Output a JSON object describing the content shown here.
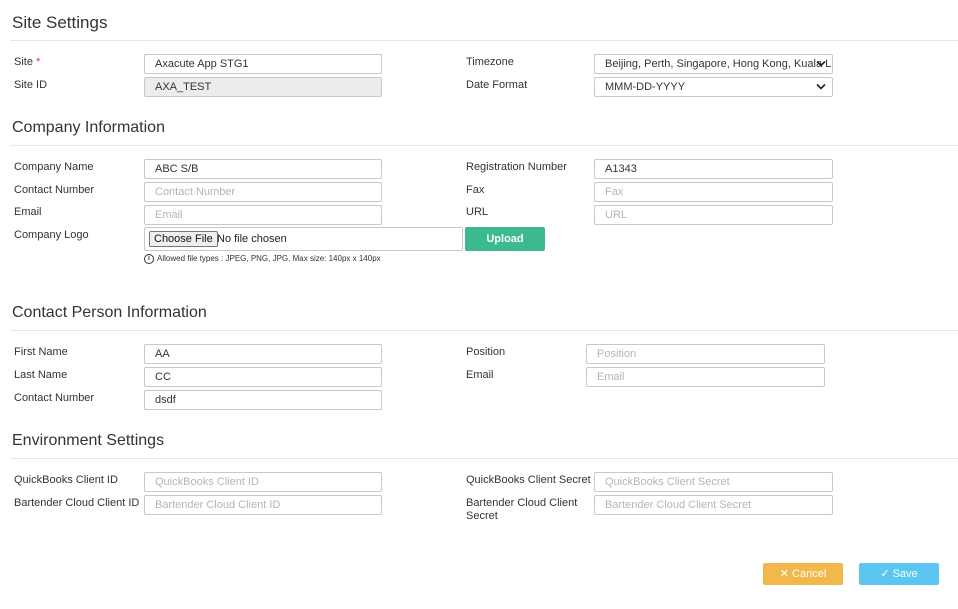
{
  "page": {
    "title": "Site Settings"
  },
  "site": {
    "site_label": "Site",
    "required_marker": "*",
    "site_value": "Axacute App STG1",
    "site_id_label": "Site ID",
    "site_id_value": "AXA_TEST",
    "timezone_label": "Timezone",
    "timezone_value": "Beijing, Perth, Singapore, Hong Kong, Kuala L",
    "date_format_label": "Date Format",
    "date_format_value": "MMM-DD-YYYY"
  },
  "company": {
    "title": "Company Information",
    "name_label": "Company Name",
    "name_value": "ABC S/B",
    "contact_label": "Contact Number",
    "contact_placeholder": "Contact Number",
    "email_label": "Email",
    "email_placeholder": "Email",
    "logo_label": "Company Logo",
    "choose_file_label": "Choose File",
    "no_file_text": "No file chosen",
    "upload_label": "Upload",
    "info_glyph": "i",
    "file_hint": "Allowed file types : JPEG, PNG, JPG. Max size: 140px x 140px",
    "registration_label": "Registration Number",
    "registration_value": "A1343",
    "fax_label": "Fax",
    "fax_placeholder": "Fax",
    "url_label": "URL",
    "url_placeholder": "URL"
  },
  "contact_person": {
    "title": "Contact Person Information",
    "first_name_label": "First Name",
    "first_name_value": "AA",
    "last_name_label": "Last Name",
    "last_name_value": "CC",
    "contact_label": "Contact Number",
    "contact_value": "dsdf",
    "position_label": "Position",
    "position_placeholder": "Position",
    "email_label": "Email",
    "email_placeholder": "Email"
  },
  "environment": {
    "title": "Environment Settings",
    "qb_id_label": "QuickBooks Client ID",
    "qb_id_placeholder": "QuickBooks Client ID",
    "bt_id_label": "Bartender Cloud Client ID",
    "bt_id_placeholder": "Bartender Cloud Client ID",
    "qb_secret_label": "QuickBooks Client Secret",
    "qb_secret_placeholder": "QuickBooks Client Secret",
    "bt_secret_label_1": "Bartender Cloud Client",
    "bt_secret_label_2": "Secret",
    "bt_secret_placeholder": "Bartender Cloud Client Secret"
  },
  "actions": {
    "cancel_icon": "✕",
    "cancel_label": "Cancel",
    "save_icon": "✓",
    "save_label": "Save"
  },
  "colors": {
    "upload": "#3cb990",
    "cancel": "#f2b84b",
    "save": "#5bc6f1",
    "required": "#e53935"
  },
  "icons": {
    "select_chevron": "chevron-down-icon",
    "info": "info-icon",
    "cancel": "close-icon",
    "save": "check-icon"
  }
}
